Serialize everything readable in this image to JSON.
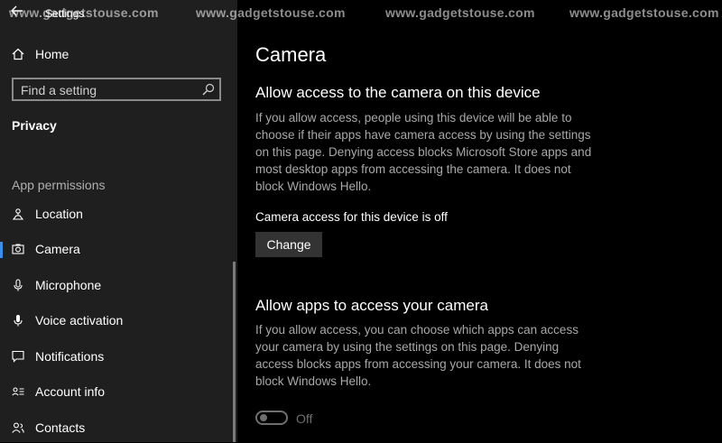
{
  "window": {
    "title": "Settings",
    "watermarks": [
      "www.gadgetstouse.com",
      "www.gadgetstouse.com",
      "www.gadgetstouse.com",
      "www.gadgetstouse.com"
    ]
  },
  "sidebar": {
    "home_label": "Home",
    "search": {
      "placeholder": "Find a setting"
    },
    "section_title": "Privacy",
    "group_header": "App permissions",
    "items": [
      {
        "label": "Location",
        "icon": "location-icon"
      },
      {
        "label": "Camera",
        "icon": "camera-icon",
        "selected": true
      },
      {
        "label": "Microphone",
        "icon": "microphone-icon"
      },
      {
        "label": "Voice activation",
        "icon": "voice-activation-icon"
      },
      {
        "label": "Notifications",
        "icon": "notifications-icon"
      },
      {
        "label": "Account info",
        "icon": "account-info-icon"
      },
      {
        "label": "Contacts",
        "icon": "contacts-icon"
      }
    ],
    "accent_color": "#3d8ee6"
  },
  "main": {
    "title": "Camera",
    "device_section": {
      "heading": "Allow access to the camera on this device",
      "description": "If you allow access, people using this device will be able to choose if their apps have camera access by using the settings on this page. Denying access blocks Microsoft Store apps and most desktop apps from accessing the camera. It does not block Windows Hello.",
      "status": "Camera access for this device is off",
      "button_label": "Change"
    },
    "apps_section": {
      "heading": "Allow apps to access your camera",
      "description": "If you allow access, you can choose which apps can access your camera by using the settings on this page. Denying access blocks apps from accessing your camera. It does not block Windows Hello.",
      "toggle_state": "Off"
    }
  }
}
